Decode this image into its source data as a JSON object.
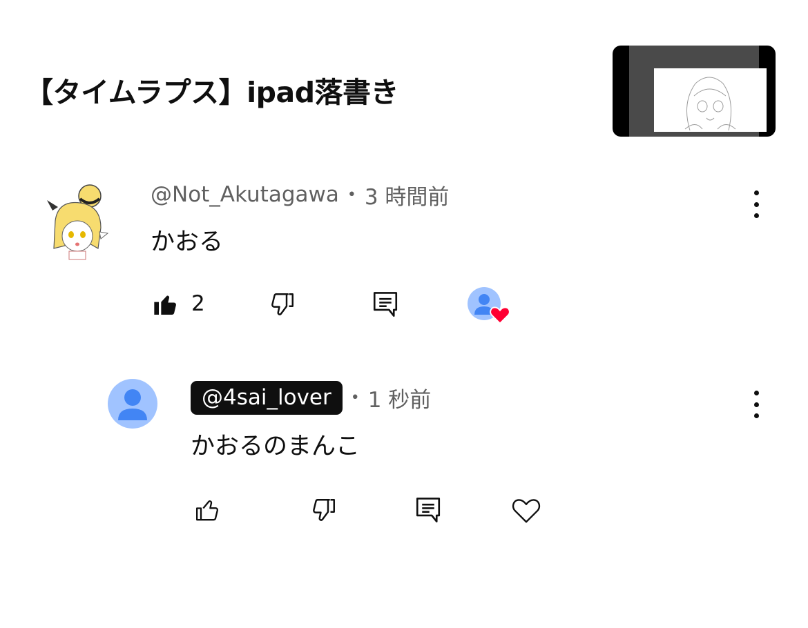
{
  "video": {
    "title": "【タイムラプス】ipad落書き"
  },
  "comment": {
    "author": "@Not_Akutagawa",
    "time": "3 時間前",
    "text": "かおる",
    "likes": "2"
  },
  "reply": {
    "author": "@4sai_lover",
    "time": "1 秒前",
    "text": "かおるのまんこ"
  },
  "separator": "•",
  "colors": {
    "heart": "#ff0033",
    "default_avatar_bg": "#a0c3ff",
    "default_avatar_fg": "#4285f4",
    "meta_text": "#606060"
  },
  "icons": {
    "like_filled": "thumb-up-filled-icon",
    "like": "thumb-up-icon",
    "dislike": "thumb-down-icon",
    "reply": "comment-reply-icon",
    "heart": "heart-icon",
    "more": "more-vert-icon"
  }
}
